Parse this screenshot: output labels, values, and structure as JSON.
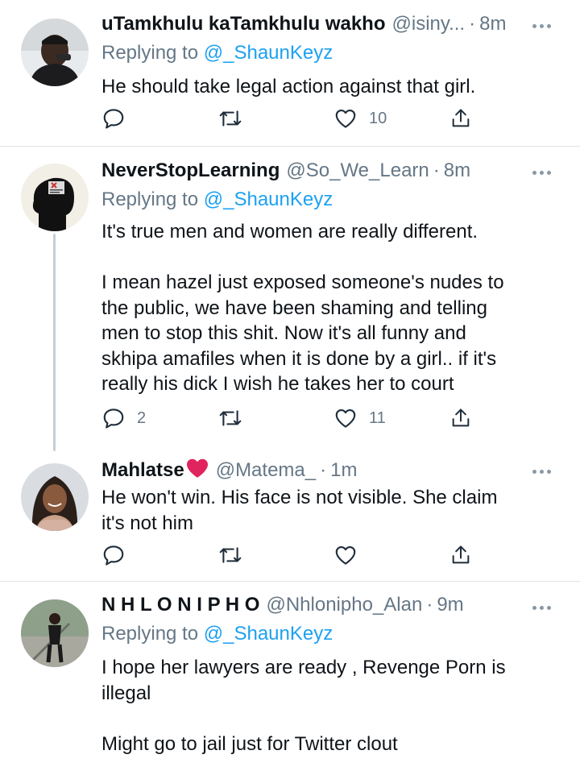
{
  "tweets": [
    {
      "name": "uTamkhulu kaTamkhulu wakho",
      "handle": "@isiny...",
      "time": "8m",
      "replying_prefix": "Replying to",
      "replying_to": "@_ShaunKeyz",
      "text_lines": [
        "He should take legal action against that girl."
      ],
      "replies": "",
      "retweets": "",
      "likes": "10"
    },
    {
      "name": "NeverStopLearning",
      "handle": "@So_We_Learn",
      "time": "8m",
      "replying_prefix": "Replying to",
      "replying_to": "@_ShaunKeyz",
      "text_lines": [
        "It's true men and women are really different.",
        "",
        "I mean hazel just exposed someone's nudes to",
        "the public, we have been shaming and telling",
        "men to stop this shit. Now it's all funny and",
        "skhipa amafiles when it is done by a girl..  if it's",
        "really his dick I wish he takes her to court"
      ],
      "replies": "2",
      "retweets": "",
      "likes": "11"
    },
    {
      "name": "Mahlatse",
      "name_emoji": "❤️",
      "handle": "@Matema_",
      "time": "1m",
      "text_lines": [
        "He won't win. His face is not visible. She claim",
        "it's not him"
      ],
      "replies": "",
      "retweets": "",
      "likes": ""
    },
    {
      "name": "N H L O N I P H O",
      "handle": "@Nhlonipho_Alan",
      "time": "9m",
      "replying_prefix": "Replying to",
      "replying_to": "@_ShaunKeyz",
      "text_lines": [
        "I hope her lawyers are ready , Revenge Porn is",
        "illegal",
        "",
        "Might go to jail just for Twitter clout"
      ]
    }
  ],
  "separator": "·",
  "icons": {
    "reply": "reply-icon",
    "retweet": "retweet-icon",
    "like": "heart-icon",
    "share": "share-icon",
    "more": "more-icon"
  },
  "colors": {
    "text": "#0f1419",
    "secondary": "#657786",
    "link": "#1da1f2",
    "divider": "#dfe4e8",
    "heart_emoji": "#e0245e"
  }
}
